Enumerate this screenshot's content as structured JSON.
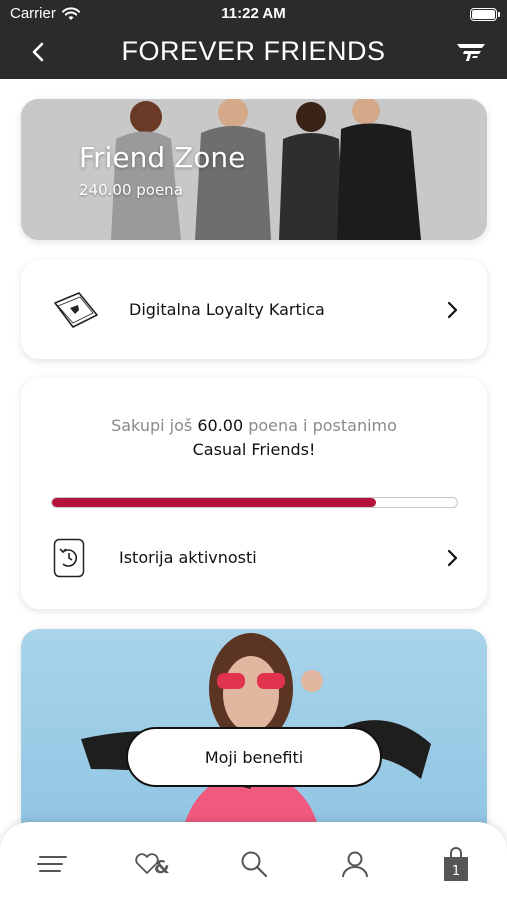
{
  "status_bar": {
    "carrier": "Carrier",
    "time": "11:22 AM"
  },
  "header": {
    "title": "FOREVER FRIENDS",
    "back_icon": "chevron-left-icon",
    "logo_icon": "brand-logo-icon"
  },
  "friend_zone": {
    "title": "Friend Zone",
    "points": "240.00 poena"
  },
  "loyalty_card": {
    "label": "Digitalna Loyalty Kartica",
    "icon": "loyalty-card-icon"
  },
  "progress": {
    "text_prefix": "Sakupi još",
    "points_needed": "60.00",
    "text_suffix": "poena i postanimo",
    "next_level": "Casual Friends!",
    "fraction": 0.8,
    "accent_color": "#b4123a"
  },
  "history": {
    "label": "Istorija aktivnosti",
    "icon": "history-icon"
  },
  "benefits": {
    "button_label": "Moji benefiti"
  },
  "tabbar": {
    "items": [
      "menu-icon",
      "wishlist-icon",
      "search-icon",
      "profile-icon",
      "cart-icon"
    ],
    "cart_count": "1"
  }
}
